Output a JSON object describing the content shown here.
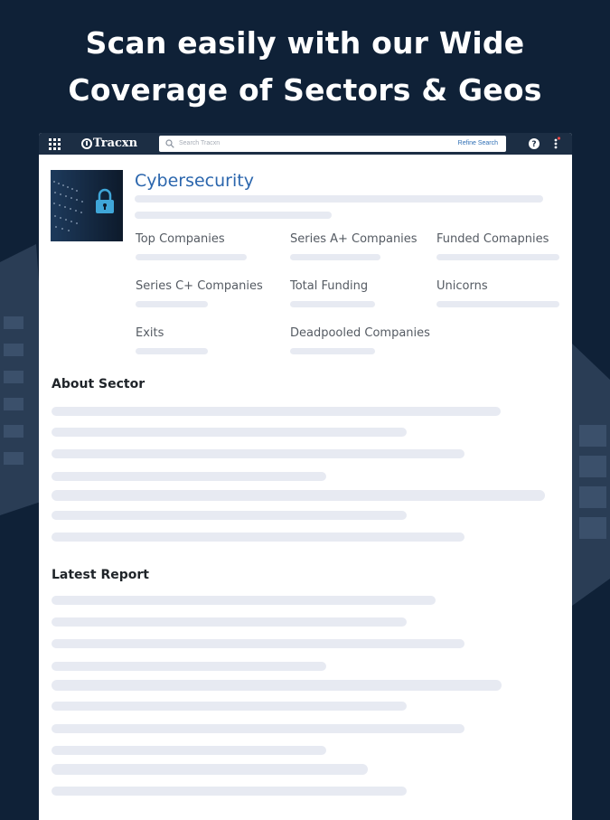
{
  "headline": {
    "line1": "Scan easily with our Wide",
    "line2": "Coverage of Sectors & Geos"
  },
  "colors": {
    "page_background": "#0f2137",
    "topbar": "#1c2e44",
    "title_blue": "#2b66ad",
    "skeleton": "#e7eaf2"
  },
  "topbar": {
    "menu_icon": "grid-icon",
    "logo_text": "Tracxn",
    "search_placeholder": "Search Tracxn",
    "refine_label": "Refine Search",
    "help_icon": "question-circle-icon",
    "more_icon": "vertical-dots-icon"
  },
  "sector": {
    "title": "Cybersecurity",
    "thumbnail_icon": "padlock-icon",
    "stats": [
      {
        "label": "Top Companies"
      },
      {
        "label": "Series A+ Companies"
      },
      {
        "label": "Funded Comapnies"
      },
      {
        "label": "Series C+ Companies"
      },
      {
        "label": "Total Funding"
      },
      {
        "label": "Unicorns"
      },
      {
        "label": "Exits"
      },
      {
        "label": "Deadpooled Companies"
      }
    ]
  },
  "about": {
    "title": "About Sector"
  },
  "report": {
    "title": "Latest Report"
  }
}
